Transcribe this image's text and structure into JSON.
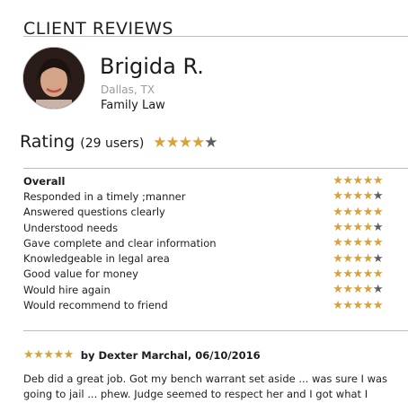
{
  "header": {
    "title": "CLIENT REVIEWS"
  },
  "lawyer": {
    "name": "Brigida R.",
    "location": "Dallas, TX",
    "practice": "Family Law"
  },
  "rating": {
    "label": "Rating",
    "count_text": "(29 users)",
    "stars": 4,
    "max_stars": 5
  },
  "criteria": [
    {
      "label": "Overall",
      "stars": 5
    },
    {
      "label": "Responded in a timely ;manner",
      "stars": 4
    },
    {
      "label": "Answered questions clearly",
      "stars": 5
    },
    {
      "label": "Understood needs",
      "stars": 4
    },
    {
      "label": "Gave complete and clear information",
      "stars": 5
    },
    {
      "label": "Knowledgeable in legal area",
      "stars": 4
    },
    {
      "label": "Good value for money",
      "stars": 5
    },
    {
      "label": "Would hire again",
      "stars": 4
    },
    {
      "label": "Would recommend to friend",
      "stars": 5
    }
  ],
  "review": {
    "stars": 5,
    "byline": "by Dexter Marchal, 06/10/2016",
    "body": "Deb did a great job. Got my bench warrant set aside ... was sure I was going to jail ... phew. Judge seemed to respect her and I got what I"
  },
  "colors": {
    "star_filled": "#d7a13b",
    "star_empty": "#5e5e5e",
    "divider": "#bdbdbd"
  },
  "icons": {
    "star": "star-icon",
    "avatar": "lawyer-photo"
  }
}
